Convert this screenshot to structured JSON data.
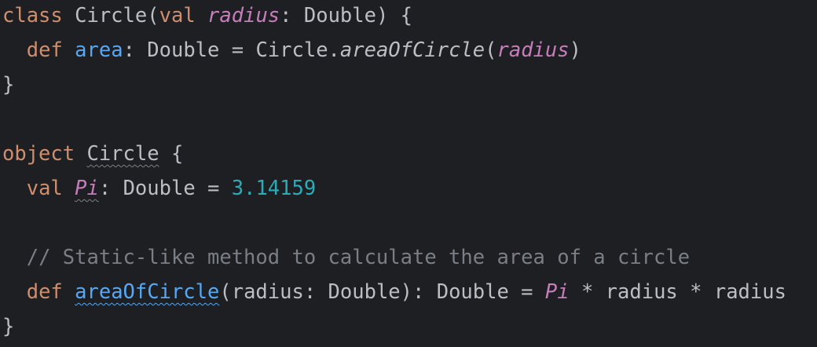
{
  "lines": [
    [
      {
        "text": "class ",
        "kind": "keyword"
      },
      {
        "text": "Circle",
        "kind": "ident"
      },
      {
        "text": "(",
        "kind": "plain"
      },
      {
        "text": "val ",
        "kind": "keyword"
      },
      {
        "text": "radius",
        "kind": "param"
      },
      {
        "text": ": Double) {",
        "kind": "plain"
      }
    ],
    [
      {
        "text": "  ",
        "kind": "plain"
      },
      {
        "text": "def ",
        "kind": "keyword"
      },
      {
        "text": "area",
        "kind": "func"
      },
      {
        "text": ": Double = Circle.",
        "kind": "plain"
      },
      {
        "text": "areaOfCircle",
        "kind": "static"
      },
      {
        "text": "(",
        "kind": "plain"
      },
      {
        "text": "radius",
        "kind": "param"
      },
      {
        "text": ")",
        "kind": "plain"
      }
    ],
    [
      {
        "text": "}",
        "kind": "plain"
      }
    ],
    [],
    [
      {
        "text": "object ",
        "kind": "keyword"
      },
      {
        "text": "Circle",
        "kind": "ident",
        "underline": "warn"
      },
      {
        "text": " {",
        "kind": "plain"
      }
    ],
    [
      {
        "text": "  ",
        "kind": "plain"
      },
      {
        "text": "val ",
        "kind": "keyword"
      },
      {
        "text": "Pi",
        "kind": "constant",
        "underline": "warn"
      },
      {
        "text": ": Double = ",
        "kind": "plain"
      },
      {
        "text": "3.14159",
        "kind": "number"
      }
    ],
    [],
    [
      {
        "text": "  ",
        "kind": "plain"
      },
      {
        "text": "// Static-like method to calculate the area of a circle",
        "kind": "comment"
      }
    ],
    [
      {
        "text": "  ",
        "kind": "plain"
      },
      {
        "text": "def ",
        "kind": "keyword"
      },
      {
        "text": "areaOfCircle",
        "kind": "func",
        "underline": "warn-blue"
      },
      {
        "text": "(radius: Double): Double = ",
        "kind": "plain"
      },
      {
        "text": "Pi",
        "kind": "constant"
      },
      {
        "text": " * radius * radius",
        "kind": "plain"
      }
    ],
    [
      {
        "text": "}",
        "kind": "plain"
      }
    ]
  ],
  "colors": {
    "background": "#1e1f22",
    "keyword": "#cf8e6d",
    "param": "#c77dbb",
    "function": "#56a8f5",
    "text": "#bcbec4",
    "number": "#2aacb8",
    "comment": "#7a7e85"
  }
}
